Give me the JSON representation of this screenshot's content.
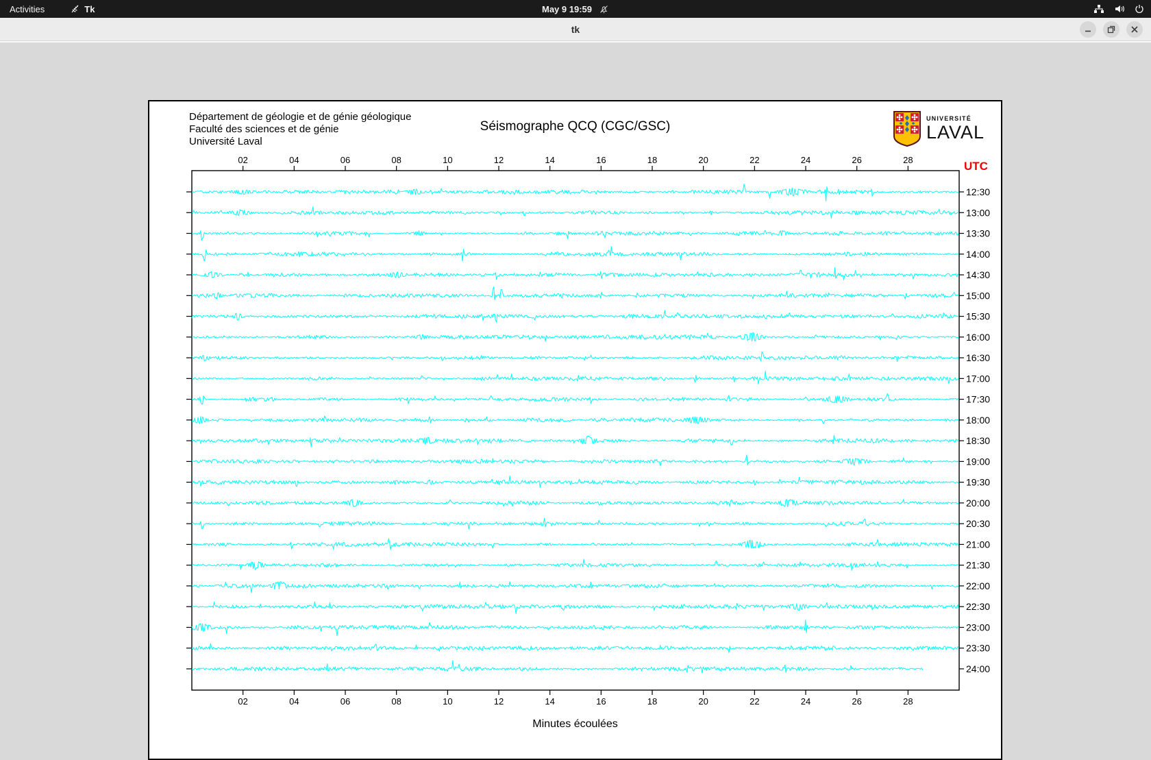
{
  "topbar": {
    "activities_label": "Activities",
    "app_name": "Tk",
    "clock": "May 9  19:59",
    "icons": [
      "notifications-disabled-icon",
      "network-wired-icon",
      "volume-icon",
      "power-icon"
    ]
  },
  "titlebar": {
    "title": "tk"
  },
  "window": {
    "header_line1": "Département de géologie et de génie géologique",
    "header_line2": "Faculté des sciences et de génie",
    "header_line3": "Université Laval",
    "plot_title": "Séismographe QCQ (CGC/GSC)"
  },
  "logo": {
    "line1": "UNIVERSITÉ",
    "line2": "LAVAL",
    "gold": "#ffc103",
    "red": "#d31f2c",
    "blue": "#1f6fb5",
    "border": "#5a1620"
  },
  "chart_data": {
    "type": "line",
    "subtype": "seismogram-helicorder",
    "title": "Séismographe QCQ (CGC/GSC)",
    "xlabel": "Minutes écoulées",
    "right_axis_title": "UTC",
    "x_range": [
      0,
      30
    ],
    "x_ticks": [
      "02",
      "04",
      "06",
      "08",
      "10",
      "12",
      "14",
      "16",
      "18",
      "20",
      "22",
      "24",
      "26",
      "28"
    ],
    "x_tick_values": [
      2,
      4,
      6,
      8,
      10,
      12,
      14,
      16,
      18,
      20,
      22,
      24,
      26,
      28
    ],
    "trace_color": "#00ffff",
    "utc_color": "#f20000",
    "grid": false,
    "rows": [
      {
        "label": "12:30",
        "end_minute": 30,
        "events": [
          [
            2.0,
            4,
            0.8
          ],
          [
            8.7,
            5,
            0.6
          ],
          [
            21.6,
            16,
            0.06
          ],
          [
            22.6,
            12,
            0.06
          ],
          [
            23.5,
            6,
            0.9
          ],
          [
            24.8,
            18,
            0.06
          ],
          [
            25.3,
            8,
            0.06
          ],
          [
            26.6,
            9,
            0.06
          ]
        ]
      },
      {
        "label": "13:00",
        "end_minute": 30,
        "events": [
          [
            1.9,
            5,
            0.7
          ],
          [
            13.0,
            8,
            0.06
          ],
          [
            20.3,
            6,
            0.06
          ],
          [
            26.0,
            4,
            0.5
          ]
        ]
      },
      {
        "label": "13:30",
        "end_minute": 30,
        "events": [
          [
            0.4,
            14,
            0.1
          ],
          [
            4.9,
            7,
            0.06
          ],
          [
            5.4,
            7,
            0.06
          ],
          [
            6.8,
            5,
            0.06
          ],
          [
            8.9,
            4,
            0.4
          ],
          [
            14.7,
            9,
            0.06
          ],
          [
            19.5,
            5,
            0.06
          ],
          [
            22.4,
            7,
            0.06
          ],
          [
            23.1,
            5,
            0.4
          ],
          [
            27.8,
            5,
            0.06
          ]
        ]
      },
      {
        "label": "14:00",
        "end_minute": 30,
        "events": [
          [
            0.5,
            12,
            0.12
          ],
          [
            4.2,
            7,
            0.06
          ],
          [
            10.6,
            14,
            0.06
          ],
          [
            16.3,
            8,
            0.06
          ]
        ]
      },
      {
        "label": "14:30",
        "end_minute": 30,
        "events": [
          [
            0.8,
            5,
            0.6
          ],
          [
            2.2,
            7,
            0.06
          ],
          [
            8.0,
            5,
            0.6
          ],
          [
            11.9,
            8,
            0.06
          ],
          [
            13.6,
            6,
            0.06
          ],
          [
            16.0,
            8,
            0.06
          ],
          [
            23.8,
            11,
            0.06
          ]
        ]
      },
      {
        "label": "15:00",
        "end_minute": 30,
        "events": [
          [
            1.0,
            6,
            0.3
          ],
          [
            11.8,
            18,
            0.08
          ],
          [
            12.1,
            14,
            0.08
          ],
          [
            16.0,
            8,
            0.06
          ],
          [
            17.4,
            6,
            0.06
          ],
          [
            24.9,
            5,
            0.06
          ],
          [
            27.9,
            7,
            0.06
          ],
          [
            29.8,
            9,
            0.06
          ]
        ]
      },
      {
        "label": "15:30",
        "end_minute": 30,
        "events": [
          [
            1.8,
            6,
            0.3
          ],
          [
            11.9,
            11,
            0.06
          ],
          [
            13.4,
            6,
            0.06
          ],
          [
            19.0,
            9,
            0.06
          ],
          [
            20.0,
            6,
            0.06
          ],
          [
            27.4,
            7,
            0.06
          ],
          [
            29.4,
            8,
            0.06
          ]
        ]
      },
      {
        "label": "16:00",
        "end_minute": 30,
        "events": [
          [
            9.0,
            4,
            0.5
          ],
          [
            21.9,
            7,
            0.7
          ],
          [
            24.4,
            5,
            0.06
          ]
        ]
      },
      {
        "label": "16:30",
        "end_minute": 30,
        "events": [
          [
            0.5,
            5,
            0.3
          ],
          [
            9.8,
            9,
            0.06
          ],
          [
            22.3,
            12,
            0.08
          ],
          [
            24.4,
            5,
            0.06
          ]
        ]
      },
      {
        "label": "17:00",
        "end_minute": 30,
        "events": [
          [
            9.0,
            7,
            0.06
          ],
          [
            15.1,
            9,
            0.06
          ],
          [
            19.7,
            10,
            0.06
          ],
          [
            21.2,
            6,
            0.06
          ],
          [
            25.7,
            7,
            0.06
          ]
        ]
      },
      {
        "label": "17:30",
        "end_minute": 30,
        "events": [
          [
            0.4,
            9,
            0.15
          ],
          [
            11.7,
            7,
            0.06
          ],
          [
            15.6,
            8,
            0.06
          ],
          [
            21.0,
            10,
            0.06
          ],
          [
            24.0,
            5,
            0.06
          ],
          [
            25.2,
            6,
            0.8
          ],
          [
            27.2,
            9,
            0.1
          ]
        ]
      },
      {
        "label": "18:00",
        "end_minute": 30,
        "events": [
          [
            0.3,
            6,
            0.5
          ],
          [
            5.2,
            9,
            0.06
          ],
          [
            9.3,
            9,
            0.06
          ],
          [
            10.7,
            6,
            0.06
          ],
          [
            17.7,
            5,
            0.06
          ],
          [
            19.7,
            6,
            0.8
          ],
          [
            24.7,
            9,
            0.06
          ]
        ]
      },
      {
        "label": "18:30",
        "end_minute": 30,
        "events": [
          [
            9.2,
            6,
            0.6
          ],
          [
            15.5,
            8,
            0.5
          ],
          [
            21.1,
            11,
            0.08
          ],
          [
            25.1,
            9,
            0.06
          ]
        ]
      },
      {
        "label": "19:00",
        "end_minute": 30,
        "events": [
          [
            21.7,
            12,
            0.08
          ],
          [
            25.9,
            6,
            0.8
          ],
          [
            26.4,
            5,
            0.06
          ]
        ]
      },
      {
        "label": "19:30",
        "end_minute": 30,
        "events": [
          [
            4.1,
            11,
            0.06
          ],
          [
            9.3,
            4,
            0.4
          ],
          [
            22.0,
            6,
            0.06
          ]
        ]
      },
      {
        "label": "20:00",
        "end_minute": 30,
        "events": [
          [
            6.3,
            6,
            0.6
          ],
          [
            10.1,
            7,
            0.06
          ],
          [
            21.1,
            8,
            0.06
          ],
          [
            23.3,
            7,
            0.6
          ],
          [
            26.9,
            5,
            0.06
          ]
        ]
      },
      {
        "label": "20:30",
        "end_minute": 30,
        "events": [
          [
            0.4,
            10,
            0.1
          ],
          [
            5.0,
            7,
            0.06
          ],
          [
            13.8,
            12,
            0.06
          ],
          [
            24.8,
            6,
            0.06
          ],
          [
            26.3,
            11,
            0.08
          ]
        ]
      },
      {
        "label": "21:00",
        "end_minute": 30,
        "events": [
          [
            3.9,
            8,
            0.06
          ],
          [
            7.7,
            10,
            0.06
          ],
          [
            21.9,
            7,
            0.7
          ]
        ]
      },
      {
        "label": "21:30",
        "end_minute": 30,
        "events": [
          [
            2.5,
            7,
            0.5
          ],
          [
            20.5,
            8,
            0.06
          ],
          [
            25.8,
            8,
            0.06
          ]
        ]
      },
      {
        "label": "22:00",
        "end_minute": 30,
        "events": [
          [
            3.4,
            8,
            0.5
          ],
          [
            8.9,
            6,
            0.06
          ],
          [
            15.6,
            10,
            0.06
          ]
        ]
      },
      {
        "label": "22:30",
        "end_minute": 30,
        "events": [
          [
            21.3,
            10,
            0.06
          ],
          [
            23.7,
            6,
            0.6
          ],
          [
            26.6,
            5,
            0.06
          ]
        ]
      },
      {
        "label": "23:00",
        "end_minute": 30,
        "events": [
          [
            0.4,
            7,
            0.6
          ],
          [
            9.3,
            8,
            0.06
          ],
          [
            24.0,
            14,
            0.08
          ]
        ]
      },
      {
        "label": "23:30",
        "end_minute": 30,
        "events": [
          [
            7.2,
            12,
            0.06
          ],
          [
            21.0,
            7,
            0.06
          ]
        ]
      },
      {
        "label": "24:00",
        "end_minute": 28.6,
        "events": [
          [
            23.2,
            10,
            0.06
          ]
        ]
      }
    ]
  }
}
